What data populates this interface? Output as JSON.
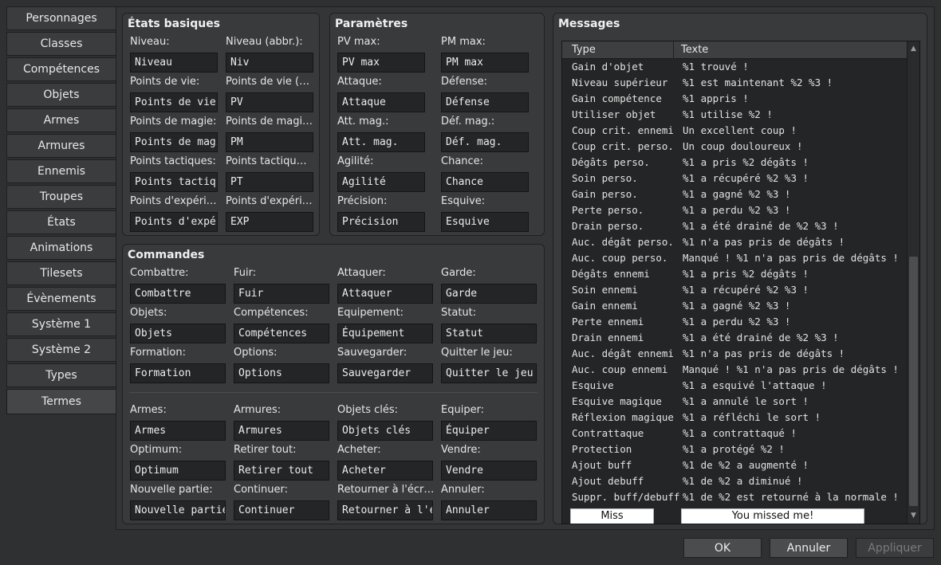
{
  "tabs": [
    "Personnages",
    "Classes",
    "Compétences",
    "Objets",
    "Armes",
    "Armures",
    "Ennemis",
    "Troupes",
    "États",
    "Animations",
    "Tilesets",
    "Évènements",
    "Système 1",
    "Système 2",
    "Types",
    "Termes"
  ],
  "basic": {
    "title": "États basiques",
    "fields": [
      {
        "label": "Niveau:",
        "value": "Niveau"
      },
      {
        "label": "Niveau (abbr.):",
        "value": "Niv"
      },
      {
        "label": "Points de vie:",
        "value": "Points de vie"
      },
      {
        "label": "Points de vie (…",
        "value": "PV"
      },
      {
        "label": "Points de magie:",
        "value": "Points de magi"
      },
      {
        "label": "Points de magi…",
        "value": "PM"
      },
      {
        "label": "Points tactiques:",
        "value": "Points tactiqu"
      },
      {
        "label": "Points tactiqu…",
        "value": "PT"
      },
      {
        "label": "Points d'expéri…",
        "value": "Points d'expér"
      },
      {
        "label": "Points d'expéri…",
        "value": "EXP"
      }
    ]
  },
  "params": {
    "title": "Paramètres",
    "fields": [
      {
        "label": "PV max:",
        "value": "PV max"
      },
      {
        "label": "PM max:",
        "value": "PM max"
      },
      {
        "label": "Attaque:",
        "value": "Attaque"
      },
      {
        "label": "Défense:",
        "value": "Défense"
      },
      {
        "label": "Att. mag.:",
        "value": "Att. mag."
      },
      {
        "label": "Déf. mag.:",
        "value": "Déf. mag."
      },
      {
        "label": "Agilité:",
        "value": "Agilité"
      },
      {
        "label": "Chance:",
        "value": "Chance"
      },
      {
        "label": "Précision:",
        "value": "Précision"
      },
      {
        "label": "Esquive:",
        "value": "Esquive"
      }
    ]
  },
  "commands": {
    "title": "Commandes",
    "fields": [
      {
        "label": "Combattre:",
        "value": "Combattre"
      },
      {
        "label": "Fuir:",
        "value": "Fuir"
      },
      {
        "label": "Attaquer:",
        "value": "Attaquer"
      },
      {
        "label": "Garde:",
        "value": "Garde"
      },
      {
        "label": "Objets:",
        "value": "Objets"
      },
      {
        "label": "Compétences:",
        "value": "Compétences"
      },
      {
        "label": "Équipement:",
        "value": "Équipement"
      },
      {
        "label": "Statut:",
        "value": "Statut"
      },
      {
        "label": "Formation:",
        "value": "Formation"
      },
      {
        "label": "Options:",
        "value": "Options"
      },
      {
        "label": "Sauvegarder:",
        "value": "Sauvegarder"
      },
      {
        "label": "Quitter le jeu:",
        "value": "Quitter le jeu"
      },
      {
        "label": "Armes:",
        "value": "Armes"
      },
      {
        "label": "Armures:",
        "value": "Armures"
      },
      {
        "label": "Objets clés:",
        "value": "Objets clés"
      },
      {
        "label": "Équiper:",
        "value": "Équiper"
      },
      {
        "label": "Optimum:",
        "value": "Optimum"
      },
      {
        "label": "Retirer tout:",
        "value": "Retirer tout"
      },
      {
        "label": "Acheter:",
        "value": "Acheter"
      },
      {
        "label": "Vendre:",
        "value": "Vendre"
      },
      {
        "label": "Nouvelle partie:",
        "value": "Nouvelle partie"
      },
      {
        "label": "Continuer:",
        "value": "Continuer"
      },
      {
        "label": "Retourner à l'écr…",
        "value": "Retourner à l'éc"
      },
      {
        "label": "Annuler:",
        "value": "Annuler"
      }
    ]
  },
  "messages": {
    "title": "Messages",
    "col_type": "Type",
    "col_text": "Texte",
    "rows": [
      {
        "type": "Gain d'objet",
        "text": "%1 trouvé !"
      },
      {
        "type": "Niveau supérieur",
        "text": "%1 est maintenant %2 %3 !"
      },
      {
        "type": "Gain compétence",
        "text": "%1 appris !"
      },
      {
        "type": "Utiliser objet",
        "text": "%1 utilise %2 !"
      },
      {
        "type": "Coup crit. ennemi",
        "text": "Un excellent coup !"
      },
      {
        "type": "Coup crit. perso.",
        "text": "Un coup douloureux !"
      },
      {
        "type": "Dégâts perso.",
        "text": "%1 a pris %2 dégâts !"
      },
      {
        "type": "Soin perso.",
        "text": "%1 a récupéré %2 %3 !"
      },
      {
        "type": "Gain perso.",
        "text": "%1 a gagné %2 %3 !"
      },
      {
        "type": "Perte perso.",
        "text": "%1 a perdu %2 %3 !"
      },
      {
        "type": "Drain perso.",
        "text": "%1 a été drainé de %2 %3 !"
      },
      {
        "type": "Auc. dégât perso.",
        "text": "%1 n'a pas pris de dégâts !"
      },
      {
        "type": "Auc. coup perso.",
        "text": "Manqué ! %1 n'a pas pris de dégâts !"
      },
      {
        "type": "Dégâts ennemi",
        "text": "%1 a pris %2 dégâts !"
      },
      {
        "type": "Soin ennemi",
        "text": "%1 a récupéré %2 %3 !"
      },
      {
        "type": "Gain ennemi",
        "text": "%1 a gagné %2 %3 !"
      },
      {
        "type": "Perte ennemi",
        "text": "%1 a perdu %2 %3 !"
      },
      {
        "type": "Drain ennemi",
        "text": "%1 a été drainé de %2 %3 !"
      },
      {
        "type": "Auc. dégât ennemi",
        "text": "%1 n'a pas pris de dégâts !"
      },
      {
        "type": "Auc. coup ennemi",
        "text": "Manqué ! %1 n'a pas pris de dégâts !"
      },
      {
        "type": "Esquive",
        "text": "%1 a esquivé l'attaque !"
      },
      {
        "type": "Esquive magique",
        "text": "%1 a annulé le sort !"
      },
      {
        "type": "Réflexion magique",
        "text": "%1 a réfléchi le sort !"
      },
      {
        "type": "Contrattaque",
        "text": "%1 a contrattaqué !"
      },
      {
        "type": "Protection",
        "text": "%1 a protégé %2 !"
      },
      {
        "type": "Ajout buff",
        "text": "%1 de %2 a augmenté !"
      },
      {
        "type": "Ajout debuff",
        "text": "%1 de %2 a diminué !"
      },
      {
        "type": "Suppr. buff/debuff",
        "text": "%1 de %2 est retourné à la normale !"
      }
    ],
    "edit_type": "Miss",
    "edit_text": "You missed me!"
  },
  "buttons": {
    "ok": "OK",
    "cancel": "Annuler",
    "apply": "Appliquer"
  }
}
